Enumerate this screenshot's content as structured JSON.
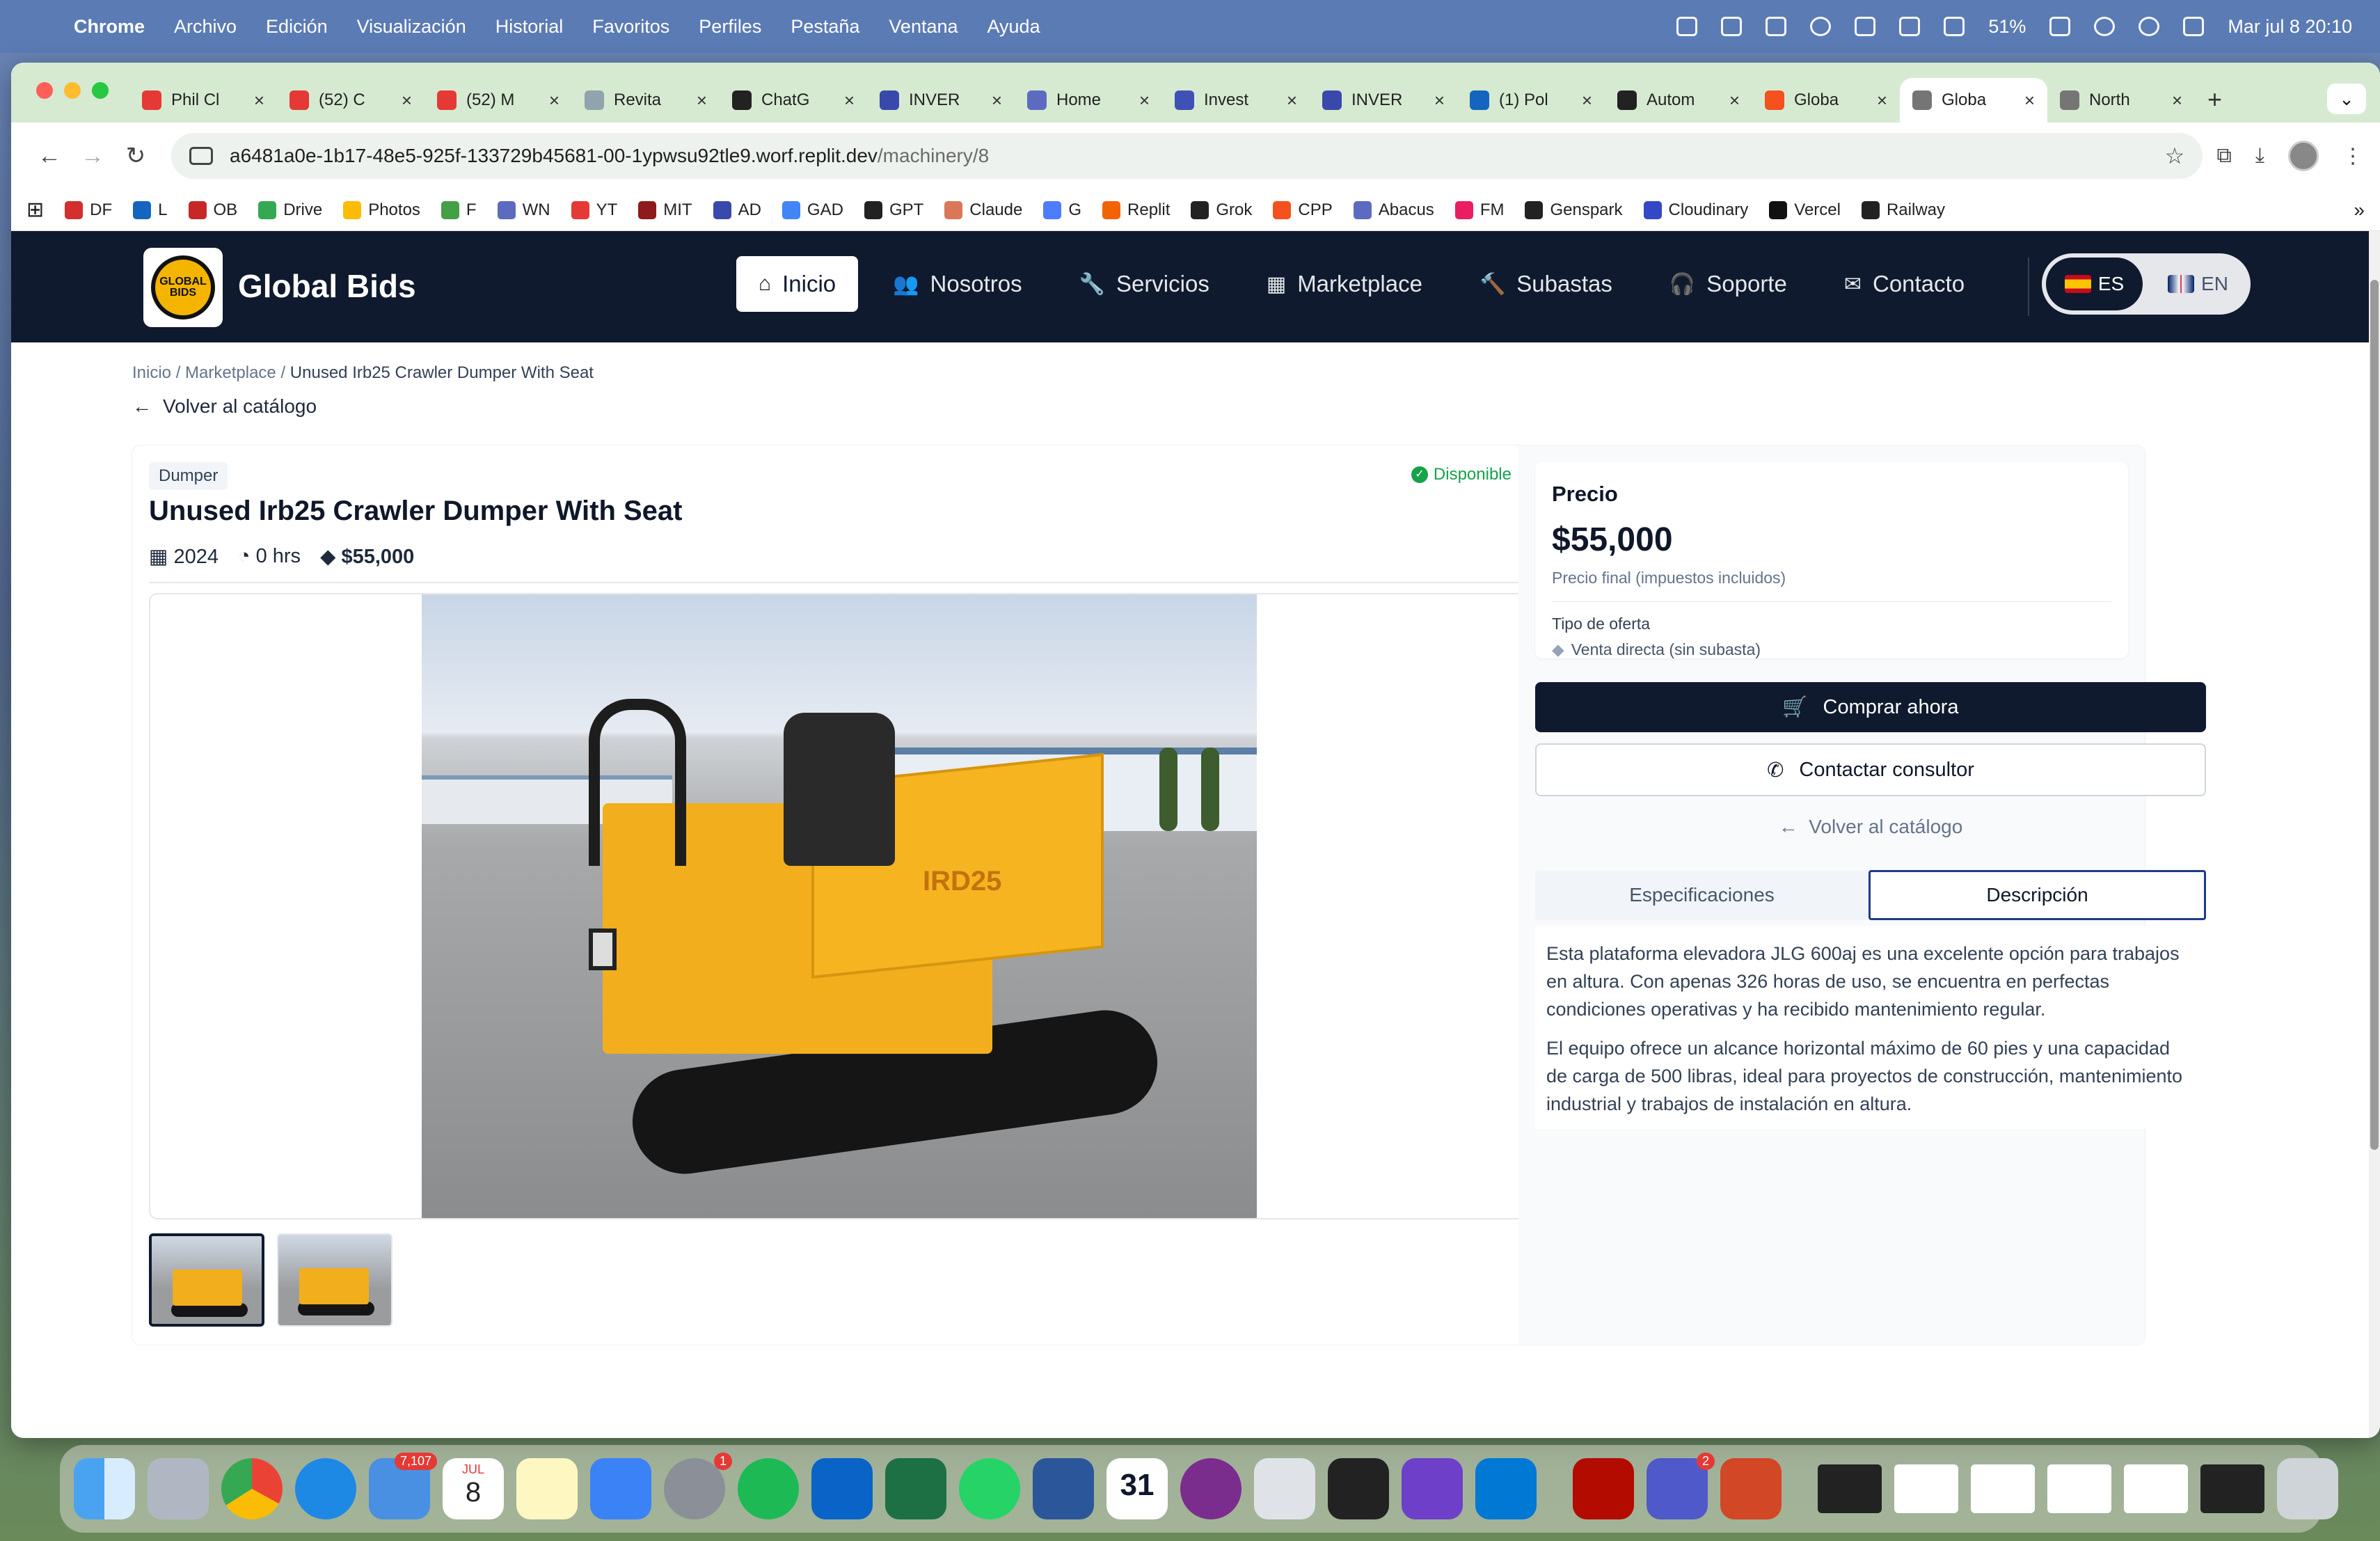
{
  "menubar": {
    "app": "Chrome",
    "items": [
      "Archivo",
      "Edición",
      "Visualización",
      "Historial",
      "Favoritos",
      "Perfiles",
      "Pestaña",
      "Ventana",
      "Ayuda"
    ],
    "battery": "51%",
    "datetime": "Mar jul 8  20:10"
  },
  "tabs": [
    {
      "label": "Phil Cl",
      "color": "#e53935"
    },
    {
      "label": "(52) C",
      "color": "#e53935"
    },
    {
      "label": "(52) M",
      "color": "#e53935"
    },
    {
      "label": "Revita",
      "color": "#90a4ae"
    },
    {
      "label": "ChatG",
      "color": "#222222"
    },
    {
      "label": "INVER",
      "color": "#3949ab"
    },
    {
      "label": "Home",
      "color": "#5c6bc0"
    },
    {
      "label": "Invest",
      "color": "#3f51b5"
    },
    {
      "label": "INVER",
      "color": "#3949ab"
    },
    {
      "label": "(1) Pol",
      "color": "#1565c0"
    },
    {
      "label": "Autom",
      "color": "#222222"
    },
    {
      "label": "Globa",
      "color": "#f4511e"
    },
    {
      "label": "Globa",
      "color": "#757575",
      "active": true
    },
    {
      "label": "North",
      "color": "#757575"
    }
  ],
  "address": {
    "host": "a6481a0e-1b17-48e5-925f-133729b45681-00-1ypwsu92tle9.worf.replit.dev",
    "path": "/machinery/8"
  },
  "bookmarks": [
    {
      "label": "DF",
      "color": "#d32f2f"
    },
    {
      "label": "L",
      "color": "#1565c0"
    },
    {
      "label": "OB",
      "color": "#c62828"
    },
    {
      "label": "Drive",
      "color": "#34a853"
    },
    {
      "label": "Photos",
      "color": "#fbbc05"
    },
    {
      "label": "F",
      "color": "#43a047"
    },
    {
      "label": "WN",
      "color": "#5c6bc0"
    },
    {
      "label": "YT",
      "color": "#e53935"
    },
    {
      "label": "MIT",
      "color": "#8d1b1b"
    },
    {
      "label": "AD",
      "color": "#3949ab"
    },
    {
      "label": "GAD",
      "color": "#4285f4"
    },
    {
      "label": "GPT",
      "color": "#222222"
    },
    {
      "label": "Claude",
      "color": "#d97757"
    },
    {
      "label": "G",
      "color": "#4e7cff"
    },
    {
      "label": "Replit",
      "color": "#f26207"
    },
    {
      "label": "Grok",
      "color": "#222222"
    },
    {
      "label": "CPP",
      "color": "#f4511e"
    },
    {
      "label": "Abacus",
      "color": "#5c6bc0"
    },
    {
      "label": "FM",
      "color": "#e91e63"
    },
    {
      "label": "Genspark",
      "color": "#222222"
    },
    {
      "label": "Cloudinary",
      "color": "#3448c5"
    },
    {
      "label": "Vercel",
      "color": "#111111"
    },
    {
      "label": "Railway",
      "color": "#222222"
    }
  ],
  "site": {
    "brand": "Global Bids",
    "logo_text": "GLOBAL BIDS",
    "nav": [
      {
        "label": "Inicio",
        "icon": "⌂",
        "active": true
      },
      {
        "label": "Nosotros",
        "icon": "👥"
      },
      {
        "label": "Servicios",
        "icon": "🔧"
      },
      {
        "label": "Marketplace",
        "icon": "▦"
      },
      {
        "label": "Subastas",
        "icon": "🔨"
      },
      {
        "label": "Soporte",
        "icon": "🎧"
      },
      {
        "label": "Contacto",
        "icon": "✉"
      }
    ],
    "lang": {
      "es": "ES",
      "en": "EN"
    }
  },
  "breadcrumb": {
    "home": "Inicio",
    "section": "Marketplace",
    "current": "Unused Irb25 Crawler Dumper With Seat",
    "sep": "/"
  },
  "back_label": "Volver al catálogo",
  "product": {
    "category": "Dumper",
    "status": "Disponible",
    "title": "Unused Irb25 Crawler Dumper With Seat",
    "year": "2024",
    "hours": "0 hrs",
    "price": "$55,000",
    "image_text": "IRD25"
  },
  "pricing": {
    "label": "Precio",
    "value": "$55,000",
    "note": "Precio final (impuestos incluidos)",
    "offer_label": "Tipo de oferta",
    "offer_value": "Venta directa (sin subasta)"
  },
  "actions": {
    "buy": "Comprar ahora",
    "contact": "Contactar consultor",
    "back": "Volver al catálogo"
  },
  "detail_tabs": {
    "specs": "Especificaciones",
    "description": "Descripción"
  },
  "description": [
    "Esta plataforma elevadora JLG 600aj es una excelente opción para trabajos en altura. Con apenas 326 horas de uso, se encuentra en perfectas condiciones operativas y ha recibido mantenimiento regular.",
    "El equipo ofrece un alcance horizontal máximo de 60 pies y una capacidad de carga de 500 libras, ideal para proyectos de construcción, mantenimiento industrial y trabajos de instalación en altura."
  ],
  "dock": {
    "mail_badge": "7,107",
    "calendar_month": "JUL",
    "calendar_day": "8",
    "calendar_date": "31",
    "settings_badge": "1",
    "teams_badge": "2"
  }
}
